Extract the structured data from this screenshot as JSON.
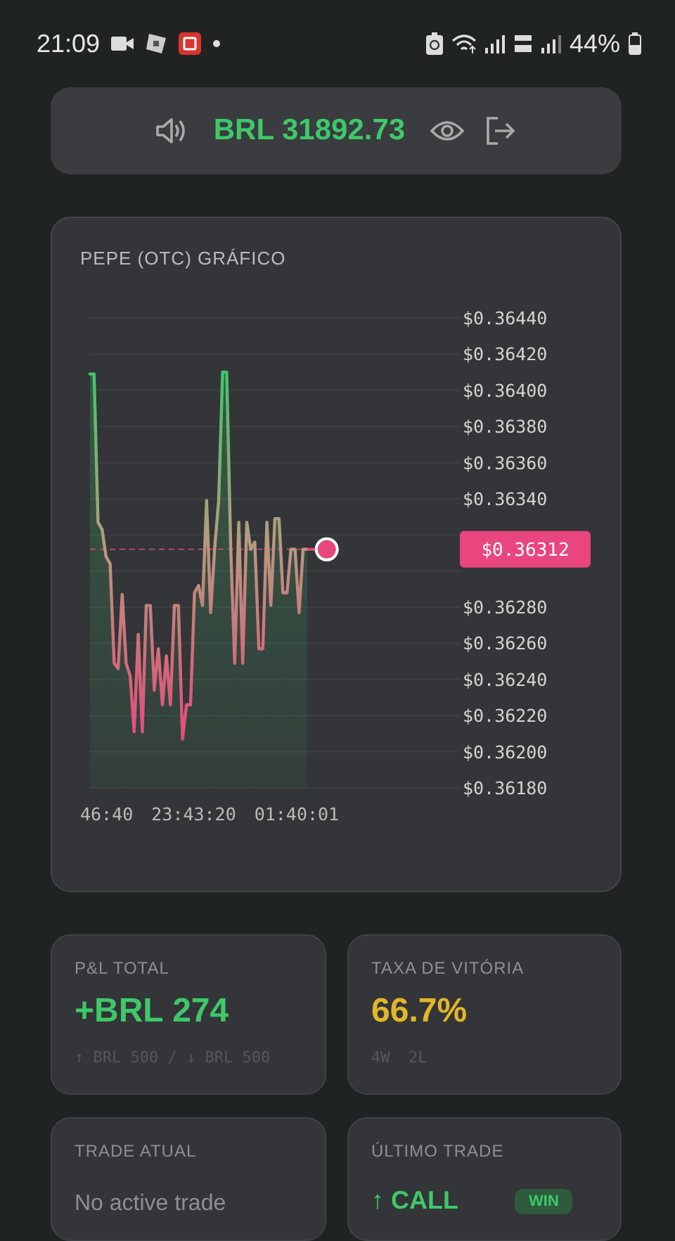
{
  "status_bar": {
    "time": "21:09",
    "battery": "44%"
  },
  "balance": {
    "amount": "BRL 31892.73"
  },
  "chart": {
    "title": "PEPE (OTC) GRÁFICO",
    "current_price": "$0.36312",
    "time_labels": [
      "46:40",
      "23:43:20",
      "01:40:01"
    ],
    "chart_data": {
      "type": "area",
      "grid": true,
      "ylim": [
        0.3618,
        0.3644
      ],
      "categories": [
        null,
        null,
        null,
        null,
        null,
        null,
        null,
        null,
        null,
        null,
        null,
        null,
        null,
        null,
        null,
        null,
        null,
        null,
        null,
        null,
        null,
        null,
        null,
        null,
        null,
        null,
        null,
        null,
        null,
        null,
        null,
        null,
        null,
        null,
        null,
        null,
        null,
        null,
        null,
        null,
        null,
        null,
        null,
        null,
        null,
        null,
        null,
        null,
        null,
        null,
        null,
        null,
        null,
        null,
        null
      ],
      "yticks": [
        {
          "value": 0.3644,
          "label": "$0.36440"
        },
        {
          "value": 0.3642,
          "label": "$0.36420"
        },
        {
          "value": 0.364,
          "label": "$0.36400"
        },
        {
          "value": 0.3638,
          "label": "$0.36380"
        },
        {
          "value": 0.3636,
          "label": "$0.36360"
        },
        {
          "value": 0.3634,
          "label": "$0.36340"
        },
        {
          "value": 0.3628,
          "label": "$0.36280"
        },
        {
          "value": 0.3626,
          "label": "$0.36260"
        },
        {
          "value": 0.3624,
          "label": "$0.36240"
        },
        {
          "value": 0.3622,
          "label": "$0.36220"
        },
        {
          "value": 0.362,
          "label": "$0.36200"
        },
        {
          "value": 0.3618,
          "label": "$0.36180"
        }
      ],
      "series": [
        {
          "color": "#3ec86a",
          "values": [
            0.36409,
            0.36409,
            0.36327,
            0.36323,
            0.36308,
            0.36304,
            0.36249,
            0.36246,
            0.36287,
            0.36249,
            0.36242,
            0.36211,
            0.36265,
            0.36211,
            0.36281,
            0.36281,
            0.36234,
            0.36257,
            0.36226,
            0.36253,
            0.36226,
            0.36281,
            0.36281,
            0.36207,
            0.36226,
            0.36226,
            0.36288,
            0.36292,
            0.36281,
            0.36339,
            0.36277,
            0.36312,
            0.36339,
            0.3641,
            0.3641,
            0.36312,
            0.36249,
            0.36327,
            0.36249,
            0.36327,
            0.36312,
            0.36316,
            0.36257,
            0.36257,
            0.36327,
            0.36281,
            0.36329,
            0.36329,
            0.36288,
            0.36288,
            0.36312,
            0.36312,
            0.36277,
            0.36312,
            0.36312
          ]
        }
      ],
      "ref_lines": [
        {
          "axis": "y",
          "value": 0.36312
        }
      ]
    }
  },
  "stats": [
    {
      "kind": "value",
      "label": "P&L TOTAL",
      "value": "+BRL 274",
      "detail": "↑ BRL 500 / ↓ BRL 500",
      "color": "#3ec86a"
    },
    {
      "kind": "value",
      "label": "TAXA DE VITÓRIA",
      "value": "66.7%",
      "detail": "4W  2L",
      "color": "#e3b52a"
    },
    {
      "kind": "empty",
      "label": "TRADE ATUAL",
      "message": "No active trade"
    },
    {
      "kind": "trade",
      "label": "ÚLTIMO TRADE",
      "direction": "↑ CALL",
      "result": "WIN"
    }
  ]
}
